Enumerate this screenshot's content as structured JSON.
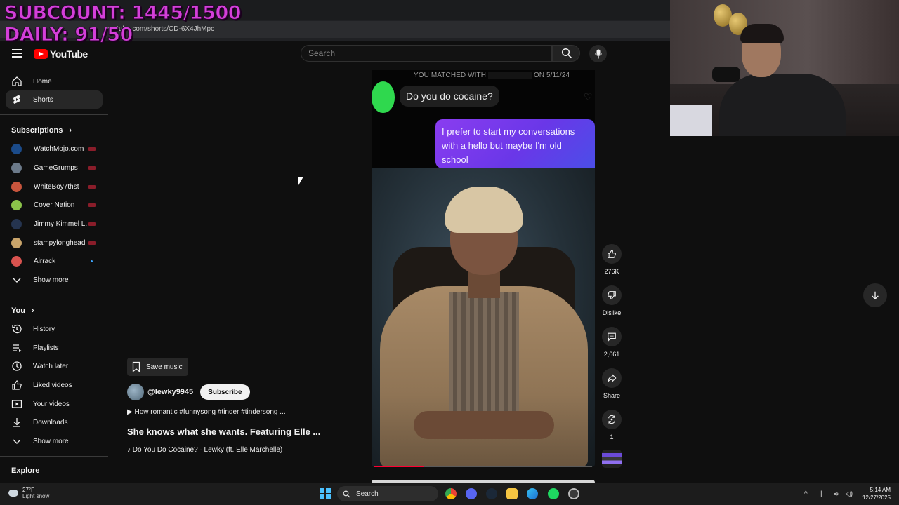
{
  "browser": {
    "tab_text": "",
    "url": "youtube.com/shorts/CD-6X4JhMpc"
  },
  "overlay": {
    "subcount": "SUBCOUNT: 1445/1500",
    "daily": "DAILY: 91/50"
  },
  "header": {
    "logo_text": "YouTube",
    "search_placeholder": "Search"
  },
  "sidebar": {
    "main": [
      {
        "label": "Home",
        "icon": "home-icon"
      },
      {
        "label": "Shorts",
        "icon": "shorts-icon"
      }
    ],
    "subscriptions_title": "Subscriptions",
    "subscriptions": [
      {
        "label": "WatchMojo.com",
        "color": "#1b4b8a"
      },
      {
        "label": "GameGrumps",
        "color": "#6c7a8a"
      },
      {
        "label": "WhiteBoy7thst",
        "color": "#c8553d"
      },
      {
        "label": "Cover Nation",
        "color": "#8bc34a"
      },
      {
        "label": "Jimmy Kimmel L...",
        "color": "#25344f"
      },
      {
        "label": "stampylonghead",
        "color": "#caa56b"
      },
      {
        "label": "Airrack",
        "color": "#d9534f"
      }
    ],
    "show_more_1": "Show more",
    "you_title": "You",
    "you_items": [
      {
        "label": "History",
        "icon": "history-icon"
      },
      {
        "label": "Playlists",
        "icon": "playlists-icon"
      },
      {
        "label": "Watch later",
        "icon": "watch-later-icon"
      },
      {
        "label": "Liked videos",
        "icon": "thumbs-up-icon"
      },
      {
        "label": "Your videos",
        "icon": "your-videos-icon"
      },
      {
        "label": "Downloads",
        "icon": "download-icon"
      }
    ],
    "show_more_2": "Show more",
    "explore_title": "Explore"
  },
  "short": {
    "matched_prefix": "YOU MATCHED WITH",
    "matched_suffix": "ON 5/11/24",
    "bubble_left": "Do you do cocaine?",
    "bubble_right": "I prefer to start my conversations with a hello but maybe I'm old school",
    "progress": 0.23
  },
  "actions": {
    "likes": "276K",
    "dislike": "Dislike",
    "comments": "2,661",
    "share": "Share",
    "remix": "1"
  },
  "meta": {
    "save_music": "Save music",
    "channel": "@lewky9945",
    "subscribe": "Subscribe",
    "description": "How romantic #funnysong #tinder #tindersong ...",
    "title": "She knows what she wants. Featuring Elle ...",
    "song": "Do You Do Cocaine? · Lewky (ft. Elle Marchelle)"
  },
  "taskbar": {
    "temp": "27°F",
    "weather": "Light snow",
    "search": "Search",
    "time": "5:14 AM",
    "date": "12/27/2025",
    "accent": "#4cc2ff"
  }
}
